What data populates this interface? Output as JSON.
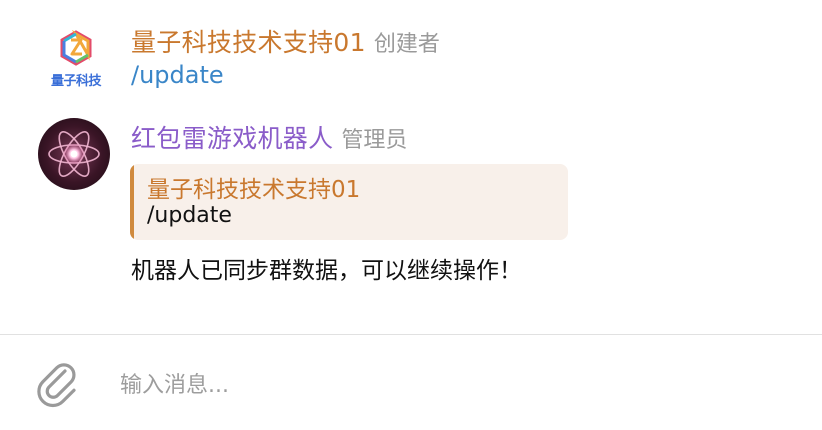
{
  "colors": {
    "sender_orange": "#c9782e",
    "sender_purple": "#8a5cc9",
    "role_gray": "#9a9a9a",
    "link_blue": "#3a86c8",
    "reply_bg": "#f8f0ea",
    "reply_bar": "#d08a3e"
  },
  "messages": [
    {
      "sender": "量子科技技术支持01",
      "role": "创建者",
      "avatar_text": "量子科技",
      "avatar_icon": "quantum-tech-logo",
      "text": "/update"
    },
    {
      "sender": "红包雷游戏机器人",
      "role": "管理员",
      "avatar_icon": "atom-glow-icon",
      "reply": {
        "sender": "量子科技技术支持01",
        "text": "/update"
      },
      "text": "机器人已同步群数据，可以继续操作！"
    }
  ],
  "composer": {
    "placeholder": "输入消息...",
    "value": "",
    "attach_icon": "paperclip-icon"
  }
}
